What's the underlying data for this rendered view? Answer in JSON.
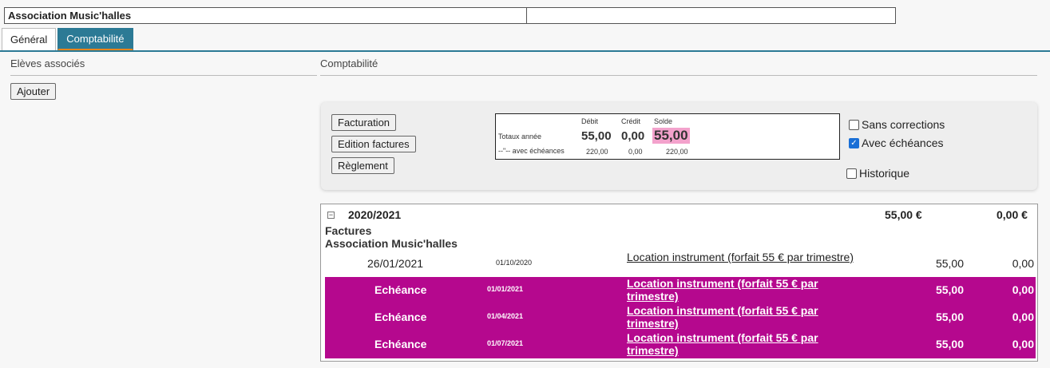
{
  "header": {
    "name": "Association Music'halles",
    "secondary": ""
  },
  "tabs": [
    {
      "label": "Général",
      "active": false
    },
    {
      "label": "Comptabilité",
      "active": true
    }
  ],
  "left": {
    "title": "Elèves associés",
    "add_label": "Ajouter"
  },
  "right": {
    "title": "Comptabilité",
    "buttons": {
      "facturation": "Facturation",
      "edition": "Edition factures",
      "reglement": "Règlement"
    },
    "totals": {
      "headers": {
        "debit": "Débit",
        "credit": "Crédit",
        "solde": "Solde"
      },
      "row1": {
        "label": "Totaux année",
        "debit": "55,00",
        "credit": "0,00",
        "solde": "55,00"
      },
      "row2": {
        "label": "--\"-- avec échéances",
        "debit": "220,00",
        "credit": "0,00",
        "solde": "220,00"
      }
    },
    "options": {
      "sans_corrections": {
        "label": "Sans corrections",
        "checked": false
      },
      "avec_echeances": {
        "label": "Avec échéances",
        "checked": true
      },
      "historique": {
        "label": "Historique",
        "checked": false
      }
    }
  },
  "ledger": {
    "year": "2020/2021",
    "year_debit": "55,00 €",
    "year_credit": "0,00 €",
    "section": "Factures",
    "client": "Association Music'halles",
    "rows": [
      {
        "label": "26/01/2021",
        "date": "01/10/2020",
        "desc": "Location instrument (forfait 55 € par trimestre)",
        "debit": "55,00",
        "credit": "0,00",
        "highlight": false
      },
      {
        "label": "Echéance",
        "date": "01/01/2021",
        "desc": "Location instrument (forfait 55 € par trimestre)",
        "debit": "55,00",
        "credit": "0,00",
        "highlight": true
      },
      {
        "label": "Echéance",
        "date": "01/04/2021",
        "desc": "Location instrument (forfait 55 € par trimestre)",
        "debit": "55,00",
        "credit": "0,00",
        "highlight": true
      },
      {
        "label": "Echéance",
        "date": "01/07/2021",
        "desc": "Location instrument (forfait 55 € par trimestre)",
        "debit": "55,00",
        "credit": "0,00",
        "highlight": true
      }
    ],
    "highlight_color": "#b5088e"
  },
  "colors": {
    "accent": "#2c7a95",
    "tab_underline": "#e8851a",
    "solde_highlight": "#f3a2cc"
  }
}
